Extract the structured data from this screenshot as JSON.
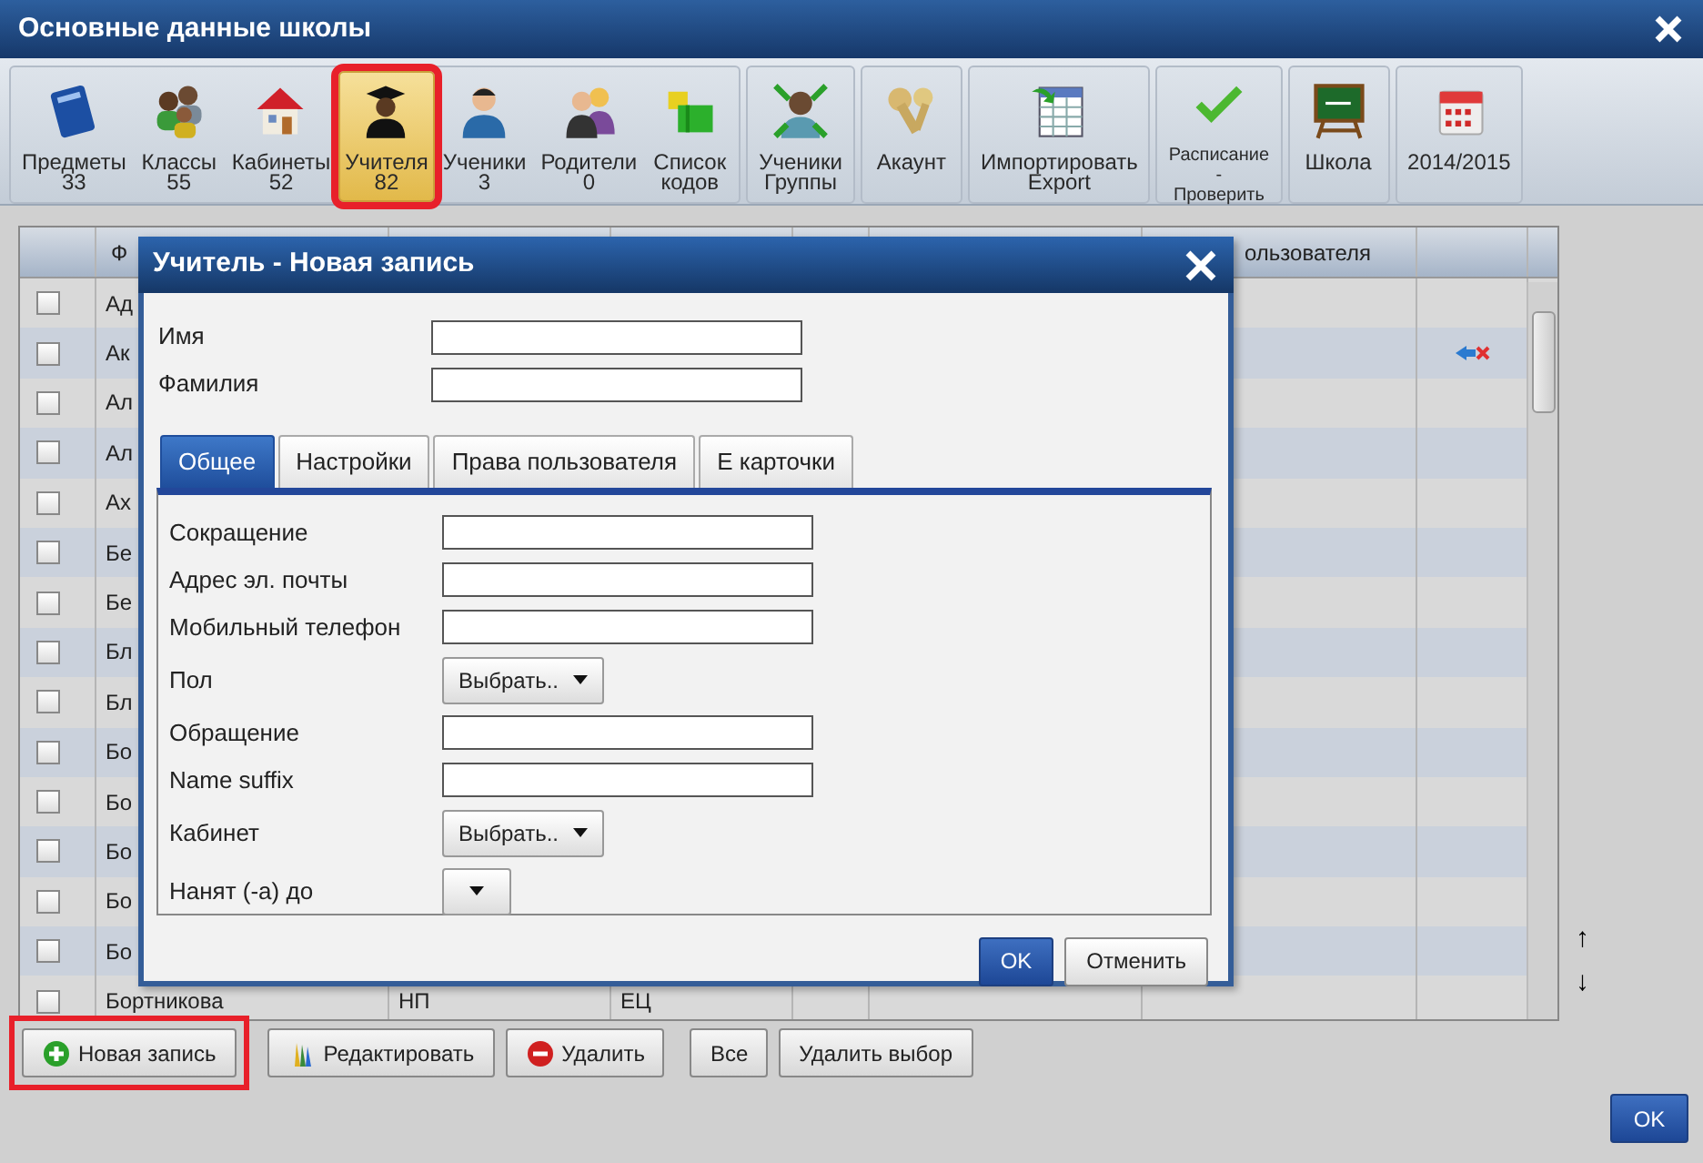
{
  "window": {
    "title": "Основные данные школы"
  },
  "toolbar": {
    "groups": [
      {
        "buttons": [
          {
            "label": "Предметы",
            "sub": "33",
            "selected": false,
            "highlighted": false
          },
          {
            "label": "Классы",
            "sub": "55",
            "selected": false,
            "highlighted": false
          },
          {
            "label": "Кабинеты",
            "sub": "52",
            "selected": false,
            "highlighted": false
          },
          {
            "label": "Учителя",
            "sub": "82",
            "selected": true,
            "highlighted": true
          },
          {
            "label": "Ученики",
            "sub": "3",
            "selected": false,
            "highlighted": false
          },
          {
            "label": "Родители",
            "sub": "0",
            "selected": false,
            "highlighted": false
          },
          {
            "label": "Список",
            "sub": "кодов",
            "selected": false,
            "highlighted": false
          }
        ]
      },
      {
        "buttons": [
          {
            "label": "Ученики",
            "sub": "Группы",
            "selected": false,
            "highlighted": false
          }
        ]
      },
      {
        "buttons": [
          {
            "label": "Акаунт",
            "selected": false,
            "highlighted": false
          }
        ]
      },
      {
        "buttons": [
          {
            "label": "Импортировать",
            "sub": "Export",
            "selected": false,
            "highlighted": false
          }
        ]
      },
      {
        "buttons": [
          {
            "label": "Расписание",
            "sub": "-",
            "sub2": "Проверить",
            "selected": false,
            "highlighted": false
          }
        ]
      },
      {
        "buttons": [
          {
            "label": "Школа",
            "selected": false,
            "highlighted": false
          }
        ]
      },
      {
        "buttons": [
          {
            "label": "2014/2015",
            "selected": false,
            "highlighted": false
          }
        ]
      }
    ]
  },
  "table": {
    "header": {
      "column_2": "Ф",
      "column_7": "ользователя"
    },
    "rows": [
      {
        "name": "Ад",
        "checked": false,
        "linked": false
      },
      {
        "name": "Ак",
        "checked": false,
        "linked": true
      },
      {
        "name": "Ал",
        "checked": false,
        "linked": false
      },
      {
        "name": "Ал",
        "checked": false,
        "linked": false
      },
      {
        "name": "Ах",
        "checked": false,
        "linked": false
      },
      {
        "name": "Бе",
        "checked": false,
        "linked": false
      },
      {
        "name": "Бе",
        "checked": false,
        "linked": false
      },
      {
        "name": "Бл",
        "checked": false,
        "linked": false
      },
      {
        "name": "Бл",
        "checked": false,
        "linked": false
      },
      {
        "name": "Бо",
        "checked": false,
        "linked": false
      },
      {
        "name": "Бо",
        "checked": false,
        "linked": false
      },
      {
        "name": "Бо",
        "checked": false,
        "linked": false
      },
      {
        "name": "Бо",
        "checked": false,
        "linked": false
      },
      {
        "name": "Бо",
        "checked": false,
        "linked": false
      },
      {
        "name": "Бортникова",
        "column_3": "НП",
        "column_4": "ЕЦ",
        "checked": false,
        "linked": false
      }
    ]
  },
  "move_buttons": [
    "↑",
    "↓"
  ],
  "modal": {
    "title": "Учитель - Новая запись",
    "name_fields": [
      {
        "label": "Имя"
      },
      {
        "label": "Фамилия"
      }
    ],
    "tabs": [
      {
        "label": "Общее",
        "selected": true
      },
      {
        "label": "Настройки",
        "selected": false
      },
      {
        "label": "Права пользователя",
        "selected": false
      },
      {
        "label": "Е карточки",
        "selected": false
      }
    ],
    "fields": [
      {
        "label": "Сокращение",
        "kind": "text"
      },
      {
        "label": "Адрес эл. почты",
        "kind": "text"
      },
      {
        "label": "Мобильный телефон",
        "kind": "text"
      },
      {
        "label": "Пол",
        "kind": "select",
        "value": "Выбрать.."
      },
      {
        "label": "Обращение",
        "kind": "text"
      },
      {
        "label": "Name suffix",
        "kind": "text"
      },
      {
        "label": "Кабинет",
        "kind": "select",
        "value": "Выбрать.."
      },
      {
        "label": "Нанят (-а) до",
        "kind": "date"
      }
    ],
    "buttons": [
      {
        "label": "OK",
        "kind": "primary"
      },
      {
        "label": "Отменить",
        "kind": "default"
      }
    ]
  },
  "bottom_buttons": [
    {
      "label": "Новая запись",
      "highlighted": true
    },
    {
      "label": "Редактировать",
      "highlighted": false
    },
    {
      "label": "Удалить",
      "highlighted": false
    },
    {
      "label": "Все",
      "highlighted": false
    },
    {
      "label": "Удалить выбор",
      "highlighted": false
    }
  ],
  "ok_button": "OK"
}
